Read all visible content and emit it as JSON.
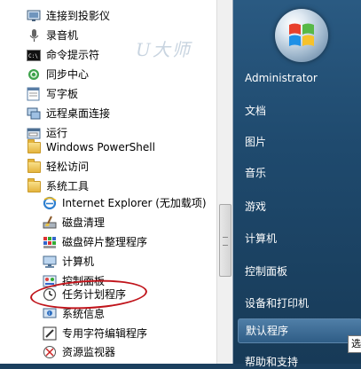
{
  "watermark": "U大师",
  "programs": [
    {
      "label": "连接到投影仪",
      "icon": "projector-icon",
      "indent": 1
    },
    {
      "label": "录音机",
      "icon": "microphone-icon",
      "indent": 1
    },
    {
      "label": "命令提示符",
      "icon": "cmd-icon",
      "indent": 1
    },
    {
      "label": "同步中心",
      "icon": "sync-icon",
      "indent": 1
    },
    {
      "label": "写字板",
      "icon": "wordpad-icon",
      "indent": 1
    },
    {
      "label": "远程桌面连接",
      "icon": "remote-desktop-icon",
      "indent": 1
    },
    {
      "label": "运行",
      "icon": "run-icon",
      "indent": 1
    },
    {
      "label": "Windows PowerShell",
      "icon": "folder-icon",
      "indent": 1
    },
    {
      "label": "轻松访问",
      "icon": "folder-icon",
      "indent": 1
    },
    {
      "label": "系统工具",
      "icon": "folder-icon",
      "indent": 1
    },
    {
      "label": "Internet Explorer (无加载项)",
      "icon": "ie-icon",
      "indent": 2
    },
    {
      "label": "磁盘清理",
      "icon": "disk-cleanup-icon",
      "indent": 2
    },
    {
      "label": "磁盘碎片整理程序",
      "icon": "defrag-icon",
      "indent": 2
    },
    {
      "label": "计算机",
      "icon": "computer-icon",
      "indent": 2
    },
    {
      "label": "控制面板",
      "icon": "control-panel-icon",
      "indent": 2
    },
    {
      "label": "任务计划程序",
      "icon": "clock-icon",
      "indent": 2
    },
    {
      "label": "系统信息",
      "icon": "system-info-icon",
      "indent": 2
    },
    {
      "label": "专用字符编辑程序",
      "icon": "char-editor-icon",
      "indent": 2
    },
    {
      "label": "资源监视器",
      "icon": "resource-monitor-icon",
      "indent": 2
    }
  ],
  "right_pane": [
    {
      "label": "Administrator"
    },
    {
      "label": "文档"
    },
    {
      "label": "图片"
    },
    {
      "label": "音乐"
    },
    {
      "label": "游戏"
    },
    {
      "label": "计算机"
    },
    {
      "label": "控制面板"
    },
    {
      "label": "设备和打印机"
    },
    {
      "label": "默认程序"
    },
    {
      "label": "帮助和支持"
    }
  ],
  "tooltip": "选",
  "colors": {
    "highlight_ellipse": "#c0141b",
    "right_pane_bg": "#1f4a6e"
  }
}
